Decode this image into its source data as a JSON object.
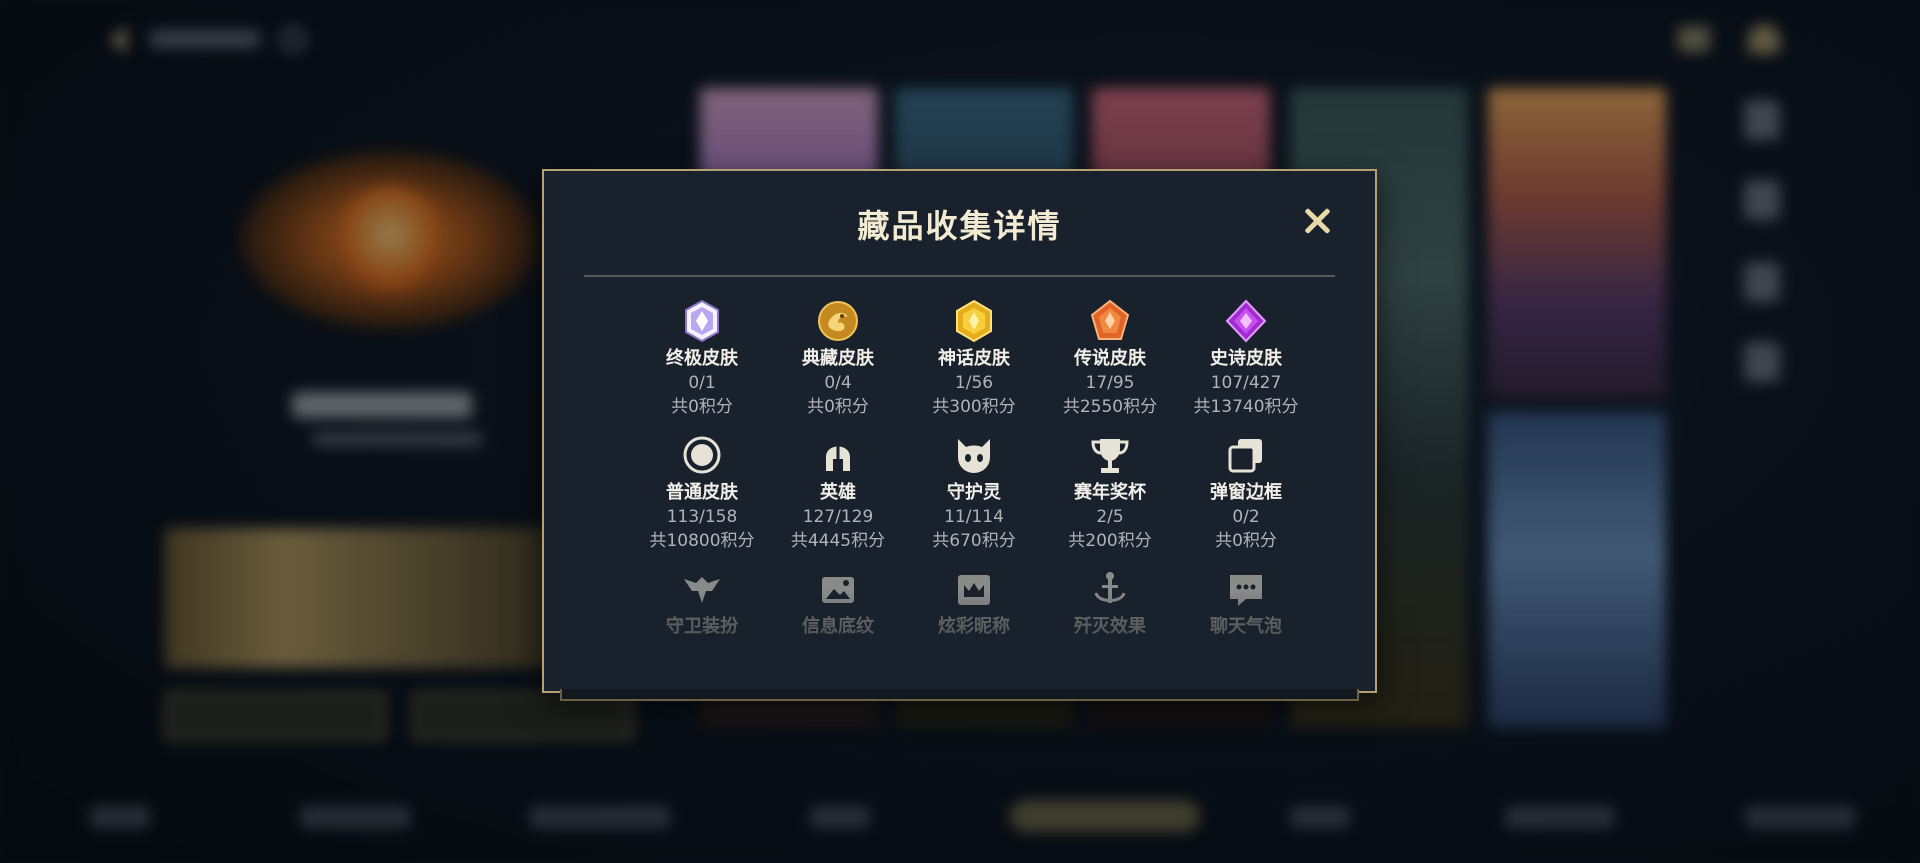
{
  "modal": {
    "title": "藏品收集详情",
    "categories": [
      {
        "label": "终极皮肤",
        "count": "0/1",
        "points": "共0积分",
        "icon": "ultimate-skin-gem-icon"
      },
      {
        "label": "典藏皮肤",
        "count": "0/4",
        "points": "共0积分",
        "icon": "collection-skin-dragon-icon"
      },
      {
        "label": "神话皮肤",
        "count": "1/56",
        "points": "共300积分",
        "icon": "mythic-skin-gem-icon"
      },
      {
        "label": "传说皮肤",
        "count": "17/95",
        "points": "共2550积分",
        "icon": "legend-skin-gem-icon"
      },
      {
        "label": "史诗皮肤",
        "count": "107/427",
        "points": "共13740积分",
        "icon": "epic-skin-gem-icon"
      },
      {
        "label": "普通皮肤",
        "count": "113/158",
        "points": "共10800积分",
        "icon": "normal-skin-ring-icon"
      },
      {
        "label": "英雄",
        "count": "127/129",
        "points": "共4445积分",
        "icon": "hero-helmet-icon"
      },
      {
        "label": "守护灵",
        "count": "11/114",
        "points": "共670积分",
        "icon": "guardian-spirit-icon"
      },
      {
        "label": "赛年奖杯",
        "count": "2/5",
        "points": "共200积分",
        "icon": "trophy-icon"
      },
      {
        "label": "弹窗边框",
        "count": "0/2",
        "points": "共0积分",
        "icon": "popup-frame-icon"
      },
      {
        "label": "守卫装扮",
        "count": "",
        "points": "",
        "icon": "guard-outfit-icon"
      },
      {
        "label": "信息底纹",
        "count": "",
        "points": "",
        "icon": "info-background-icon"
      },
      {
        "label": "炫彩昵称",
        "count": "",
        "points": "",
        "icon": "colorful-nickname-icon"
      },
      {
        "label": "歼灭效果",
        "count": "",
        "points": "",
        "icon": "annihilate-effect-icon"
      },
      {
        "label": "聊天气泡",
        "count": "",
        "points": "",
        "icon": "chat-bubble-icon"
      }
    ]
  },
  "colors": {
    "accent_gold": "#b5a170",
    "modal_bg": "#18212c",
    "title": "#f3ead2",
    "secondary_text": "#aeb3b9"
  }
}
